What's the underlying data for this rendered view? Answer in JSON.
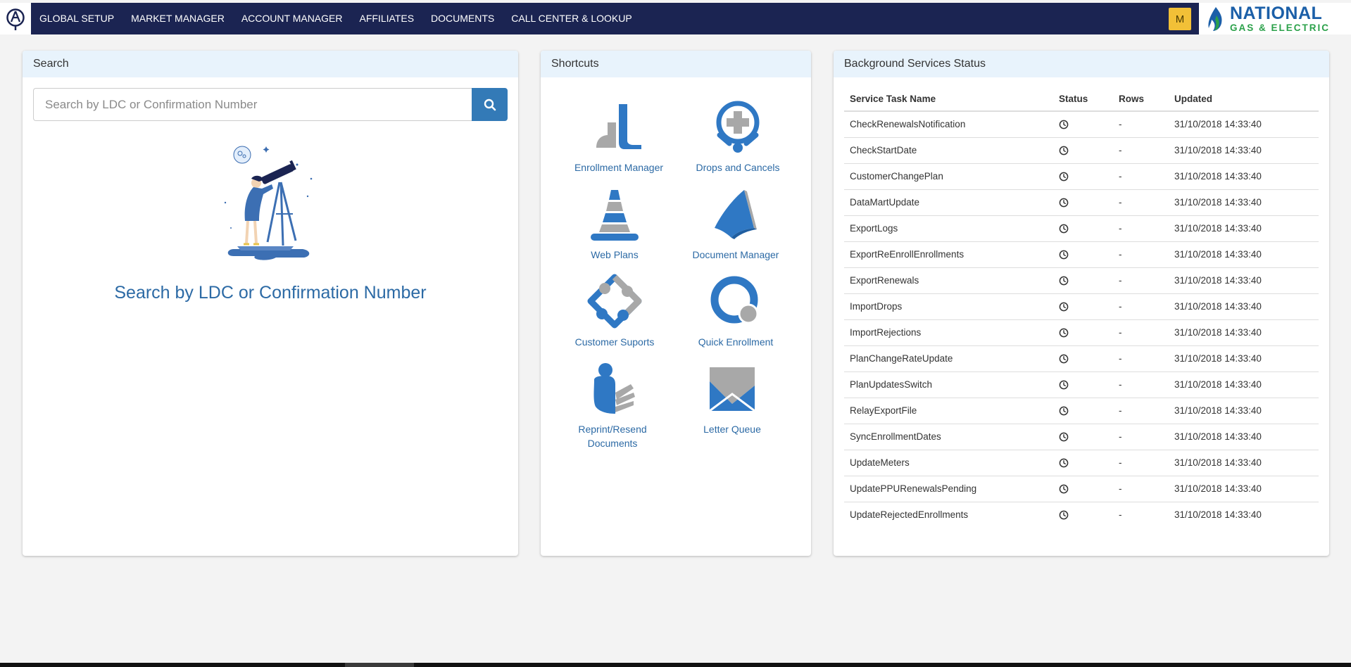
{
  "nav": {
    "items": [
      "GLOBAL SETUP",
      "MARKET MANAGER",
      "ACCOUNT MANAGER",
      "AFFILIATES",
      "DOCUMENTS",
      "CALL CENTER & LOOKUP"
    ],
    "user_initial": "M",
    "logo_main": "NATIONAL",
    "logo_sub": "GAS & ELECTRIC"
  },
  "search": {
    "title": "Search",
    "placeholder": "Search by LDC or Confirmation Number",
    "hint": "Search by LDC or Confirmation Number",
    "button_icon": "magnifier-icon"
  },
  "shortcuts": {
    "title": "Shortcuts",
    "items": [
      {
        "label": "Enrollment Manager",
        "icon": "enrollment-manager-icon"
      },
      {
        "label": "Drops and Cancels",
        "icon": "drops-cancels-icon"
      },
      {
        "label": "Web Plans",
        "icon": "pyramid-icon"
      },
      {
        "label": "Document Manager",
        "icon": "book-icon"
      },
      {
        "label": "Customer Suports",
        "icon": "support-icon"
      },
      {
        "label": "Quick Enrollment",
        "icon": "quick-enrollment-icon"
      },
      {
        "label": "Reprint/Resend Documents",
        "icon": "person-documents-icon"
      },
      {
        "label": "Letter Queue",
        "icon": "envelope-icon"
      }
    ]
  },
  "status": {
    "title": "Background Services Status",
    "columns": [
      "Service Task Name",
      "Status",
      "Rows",
      "Updated"
    ],
    "rows": [
      {
        "name": "CheckRenewalsNotification",
        "rows": "-",
        "updated": "31/10/2018 14:33:40"
      },
      {
        "name": "CheckStartDate",
        "rows": "-",
        "updated": "31/10/2018 14:33:40"
      },
      {
        "name": "CustomerChangePlan",
        "rows": "-",
        "updated": "31/10/2018 14:33:40"
      },
      {
        "name": "DataMartUpdate",
        "rows": "-",
        "updated": "31/10/2018 14:33:40"
      },
      {
        "name": "ExportLogs",
        "rows": "-",
        "updated": "31/10/2018 14:33:40"
      },
      {
        "name": "ExportReEnrollEnrollments",
        "rows": "-",
        "updated": "31/10/2018 14:33:40"
      },
      {
        "name": "ExportRenewals",
        "rows": "-",
        "updated": "31/10/2018 14:33:40"
      },
      {
        "name": "ImportDrops",
        "rows": "-",
        "updated": "31/10/2018 14:33:40"
      },
      {
        "name": "ImportRejections",
        "rows": "-",
        "updated": "31/10/2018 14:33:40"
      },
      {
        "name": "PlanChangeRateUpdate",
        "rows": "-",
        "updated": "31/10/2018 14:33:40"
      },
      {
        "name": "PlanUpdatesSwitch",
        "rows": "-",
        "updated": "31/10/2018 14:33:40"
      },
      {
        "name": "RelayExportFile",
        "rows": "-",
        "updated": "31/10/2018 14:33:40"
      },
      {
        "name": "SyncEnrollmentDates",
        "rows": "-",
        "updated": "31/10/2018 14:33:40"
      },
      {
        "name": "UpdateMeters",
        "rows": "-",
        "updated": "31/10/2018 14:33:40"
      },
      {
        "name": "UpdatePPURenewalsPending",
        "rows": "-",
        "updated": "31/10/2018 14:33:40"
      },
      {
        "name": "UpdateRejectedEnrollments",
        "rows": "-",
        "updated": "31/10/2018 14:33:40"
      }
    ]
  },
  "colors": {
    "nav_bg": "#1b2452",
    "accent": "#337ab7",
    "link": "#2c6aa5",
    "panel_header": "#e8f3fc",
    "badge": "#f2c037"
  }
}
